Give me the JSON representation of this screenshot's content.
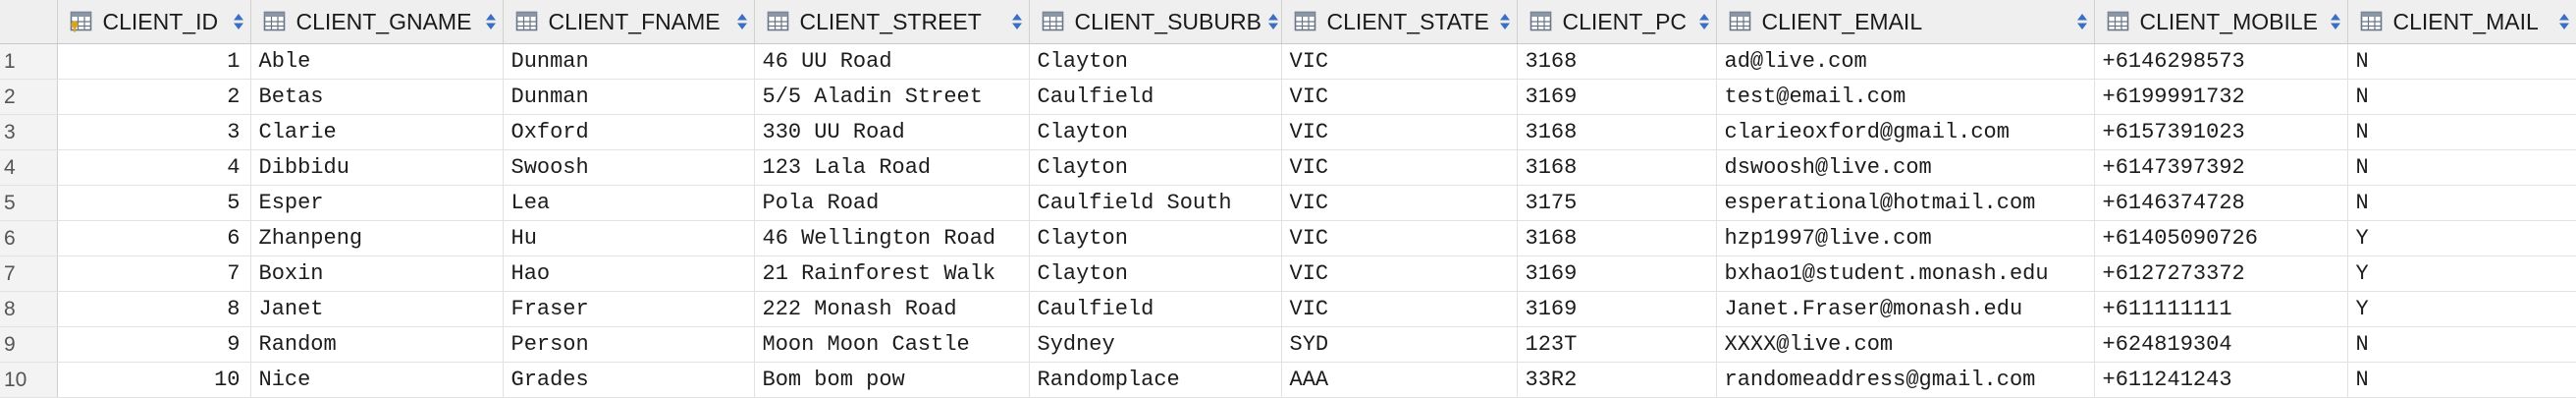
{
  "table": {
    "columns": [
      {
        "label": "CLIENT_ID",
        "key_icon": "primary-key-icon"
      },
      {
        "label": "CLIENT_GNAME"
      },
      {
        "label": "CLIENT_FNAME"
      },
      {
        "label": "CLIENT_STREET"
      },
      {
        "label": "CLIENT_SUBURB"
      },
      {
        "label": "CLIENT_STATE"
      },
      {
        "label": "CLIENT_PC"
      },
      {
        "label": "CLIENT_EMAIL"
      },
      {
        "label": "CLIENT_MOBILE"
      },
      {
        "label": "CLIENT_MAIL"
      }
    ],
    "rows": [
      {
        "n": "1",
        "cells": [
          "1",
          "Able",
          "Dunman",
          "46 UU Road",
          "Clayton",
          "VIC",
          "3168",
          "ad@live.com",
          "+6146298573",
          "N"
        ]
      },
      {
        "n": "2",
        "cells": [
          "2",
          "Betas",
          "Dunman",
          "5/5 Aladin Street",
          "Caulfield",
          "VIC",
          "3169",
          "test@email.com",
          "+6199991732",
          "N"
        ]
      },
      {
        "n": "3",
        "cells": [
          "3",
          "Clarie",
          "Oxford",
          "330 UU Road",
          "Clayton",
          "VIC",
          "3168",
          "clarieoxford@gmail.com",
          "+6157391023",
          "N"
        ]
      },
      {
        "n": "4",
        "cells": [
          "4",
          "Dibbidu",
          "Swoosh",
          "123 Lala Road",
          "Clayton",
          "VIC",
          "3168",
          "dswoosh@live.com",
          "+6147397392",
          "N"
        ]
      },
      {
        "n": "5",
        "cells": [
          "5",
          "Esper",
          "Lea",
          "Pola Road",
          "Caulfield South",
          "VIC",
          "3175",
          "esperational@hotmail.com",
          "+6146374728",
          "N"
        ]
      },
      {
        "n": "6",
        "cells": [
          "6",
          "Zhanpeng",
          "Hu",
          "46 Wellington Road",
          "Clayton",
          "VIC",
          "3168",
          "hzp1997@live.com",
          "+61405090726",
          "Y"
        ]
      },
      {
        "n": "7",
        "cells": [
          "7",
          "Boxin",
          "Hao",
          "21 Rainforest Walk",
          "Clayton",
          "VIC",
          "3169",
          "bxhao1@student.monash.edu",
          "+6127273372",
          "Y"
        ]
      },
      {
        "n": "8",
        "cells": [
          "8",
          "Janet",
          "Fraser",
          "222 Monash Road",
          "Caulfield",
          "VIC",
          "3169",
          "Janet.Fraser@monash.edu",
          "+611111111",
          "Y"
        ]
      },
      {
        "n": "9",
        "cells": [
          "9",
          "Random",
          "Person",
          "Moon Moon Castle",
          "Sydney",
          "SYD",
          "123T",
          "XXXX@live.com",
          "+624819304",
          "N"
        ]
      },
      {
        "n": "10",
        "cells": [
          "10",
          "Nice",
          "Grades",
          "Bom bom pow",
          "Randomplace",
          "AAA",
          "33R2",
          "randomeaddress@gmail.com",
          "+611241243",
          "N"
        ]
      }
    ]
  },
  "colors": {
    "header_bg": "#efefef",
    "rownum_bg": "#f3f3f3",
    "key_icon": "#d9a520",
    "sort_icon": "#3b6fc4"
  }
}
